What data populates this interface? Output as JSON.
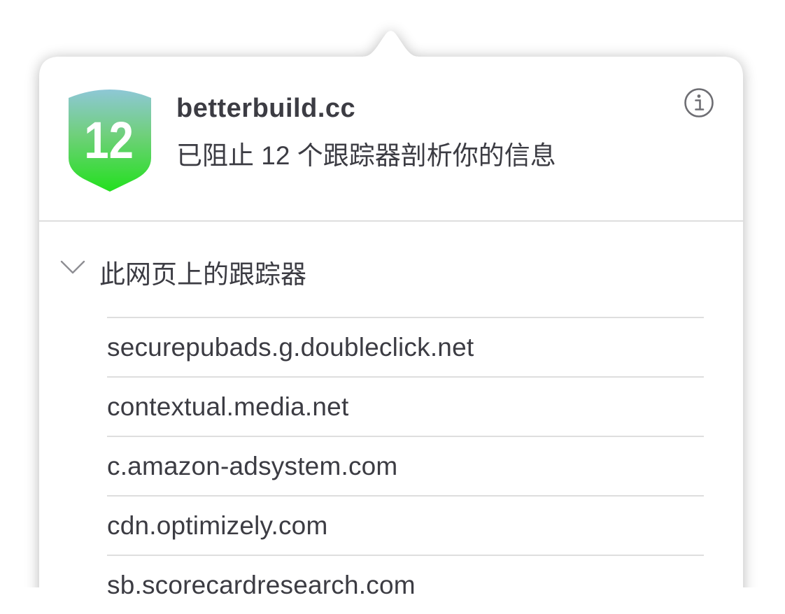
{
  "site": {
    "domain": "betterbuild.cc",
    "summary": "已阻止 12 个跟踪器剖析你的信息",
    "tracker_count": "12"
  },
  "icons": {
    "info": "info-circle-icon",
    "shield": "privacy-shield-icon",
    "chevron": "chevron-down-icon"
  },
  "section": {
    "title": "此网页上的跟踪器",
    "expanded": true
  },
  "trackers": [
    "securepubads.g.doubleclick.net",
    "contextual.media.net",
    "c.amazon-adsystem.com",
    "cdn.optimizely.com",
    "sb.scorecardresearch.com"
  ],
  "colors": {
    "shield_top": "#8ec7d6",
    "shield_bottom": "#23e01e",
    "text": "#3c3c43",
    "divider": "#dedede"
  }
}
